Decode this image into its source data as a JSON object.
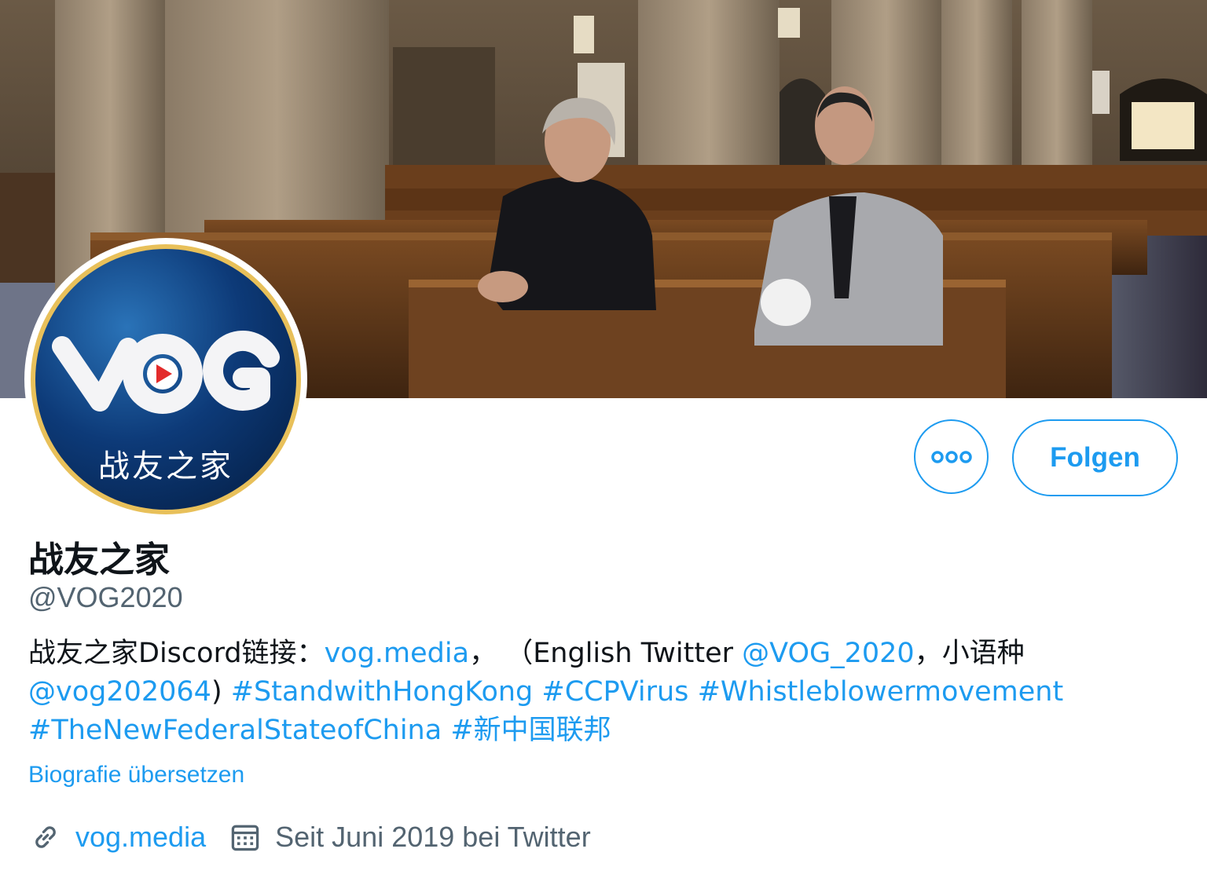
{
  "profile": {
    "display_name": "战友之家",
    "handle": "@VOG2020",
    "avatar": {
      "logo_text": "VOG",
      "caption": "战友之家"
    },
    "more_button_icon": "more-dots-icon",
    "follow_label": "Folgen",
    "bio": {
      "line1": {
        "prefix": "战友之家Discord链接：",
        "link1": "vog.media",
        "middle": "，  （English Twitter ",
        "mention1": "@VOG_2020",
        "suffix": "，小语种"
      },
      "line2": {
        "mention2": "@vog202064",
        "close": ") ",
        "tag1": "#StandwithHongKong",
        "tag2": "#CCPVirus",
        "tag3": "#Whistleblowermovement"
      },
      "line3": {
        "tag4": "#TheNewFederalStateofChina",
        "tag5": "#新中国联邦"
      }
    },
    "translate_label": "Biografie übersetzen",
    "website": {
      "icon": "link-icon",
      "label": "vog.media"
    },
    "joined": {
      "icon": "calendar-icon",
      "label": "Seit Juni 2019 bei Twitter"
    }
  },
  "colors": {
    "accent": "#1d9bf0",
    "text": "#0f1419",
    "secondary": "#536471"
  }
}
